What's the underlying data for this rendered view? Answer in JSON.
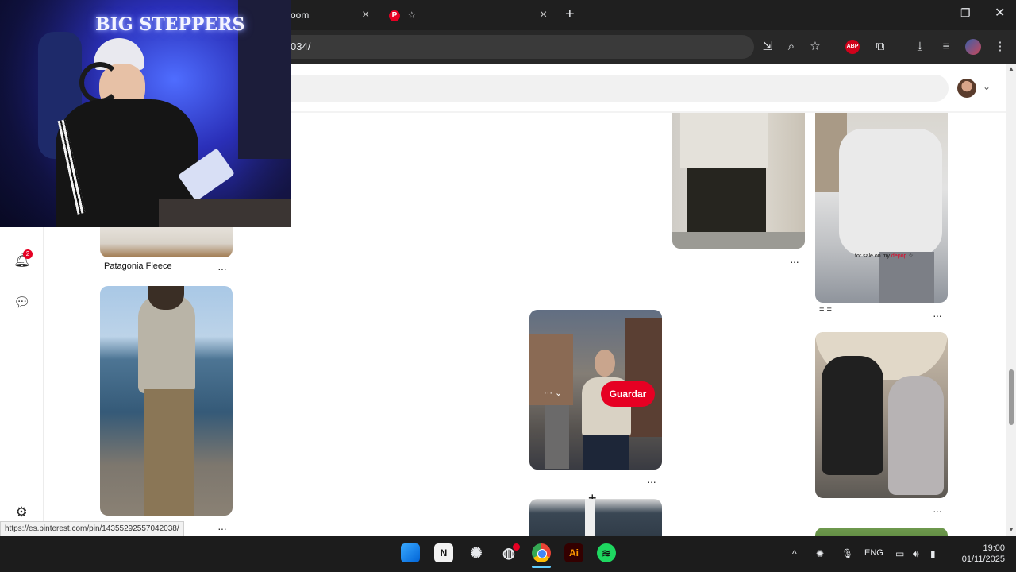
{
  "browser": {
    "tabs": [
      {
        "title": "oom"
      },
      {
        "title": "☆"
      }
    ],
    "url_fragment": "034/",
    "status_url": "https://es.pinterest.com/pin/14355292557042038/"
  },
  "webcam": {
    "neon_text": "BIG STEPPERS"
  },
  "sidebar": {
    "notification_count": "2"
  },
  "pins": [
    {
      "title": "Patagonia Fleece"
    },
    {
      "title": "= ="
    }
  ],
  "hovered_pin": {
    "save_label": "Guardar"
  },
  "colors": {
    "pinterest_red": "#e60023",
    "chrome_dark": "#1f1f1f",
    "taskbar": "#1c1c1c"
  },
  "taskbar": {
    "language": "ENG",
    "time": "19:00",
    "date": "01/11/2025",
    "apps": [
      "windows-start",
      "notion",
      "chatgpt",
      "obs",
      "chrome",
      "illustrator",
      "spotify"
    ],
    "illustrator_label": "Ai"
  }
}
